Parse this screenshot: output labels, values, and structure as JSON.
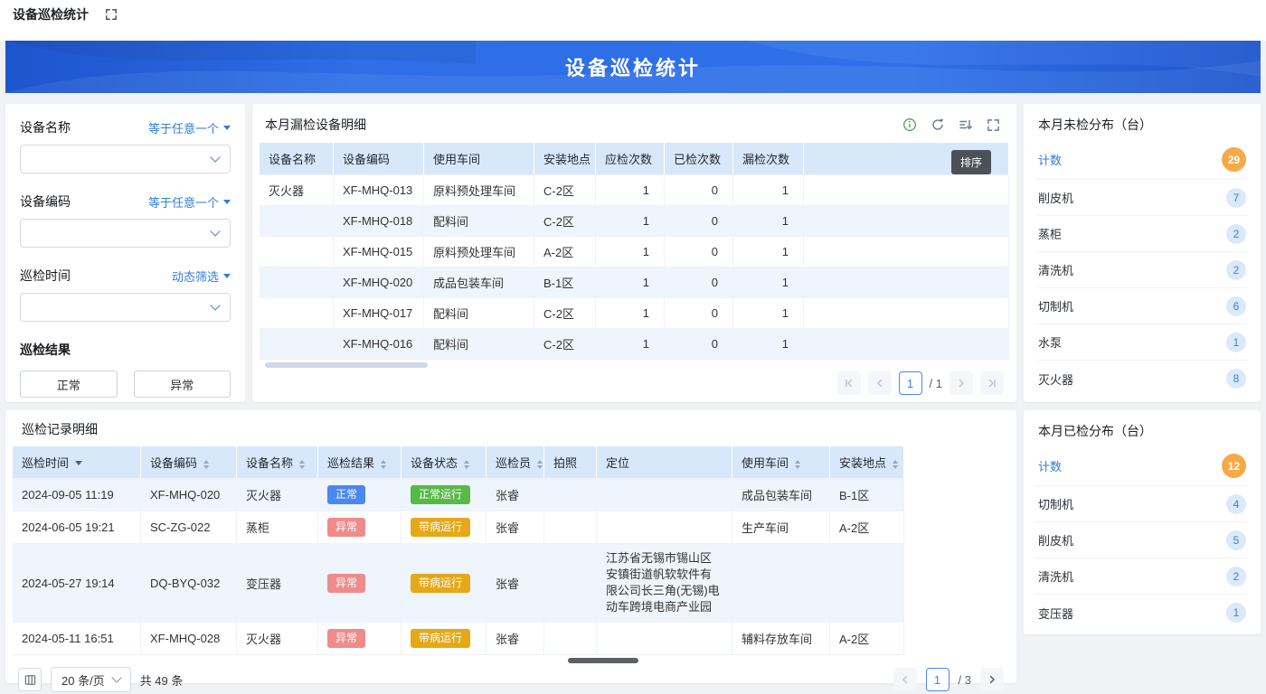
{
  "colors": {
    "banner_blue": "#2e6ee6",
    "table_header_blue": "#d7e8fa",
    "row_alt_blue": "#eef5fd",
    "link_blue": "#2e7ce0",
    "badge_normal_blue": "#4c86f0",
    "badge_abnormal_red": "#f08b8b",
    "badge_running_green": "#57b946",
    "badge_faulty_amber": "#e6a817",
    "count_badge_orange": "#f7a948",
    "item_badge_blue_bg": "#dbe9fa"
  },
  "icons": {
    "topbar": "fullscreen-expand",
    "missed_panel": [
      "info",
      "refresh",
      "sort",
      "fullscreen"
    ],
    "pagination": [
      "first-page",
      "prev-page",
      "next-page",
      "last-page"
    ],
    "records_tools": [
      "column-settings",
      "chevron-down"
    ],
    "header_sort": "up-down-arrows",
    "time_column_filter": "caret-down"
  },
  "topbar": {
    "title": "设备巡检统计"
  },
  "banner": {
    "title": "设备巡检统计"
  },
  "filters": {
    "device_name_label": "设备名称",
    "device_name_operator": "等于任意一个",
    "device_code_label": "设备编码",
    "device_code_operator": "等于任意一个",
    "time_label": "巡检时间",
    "time_operator": "动态筛选",
    "result_label": "巡检结果",
    "result_normal": "正常",
    "result_abnormal": "异常"
  },
  "missed_panel": {
    "title": "本月漏检设备明细",
    "sort_tooltip": "排序",
    "columns": [
      "设备名称",
      "设备编码",
      "使用车间",
      "安装地点",
      "应检次数",
      "已检次数",
      "漏检次数"
    ],
    "rows": [
      {
        "name": "灭火器",
        "code": "XF-MHQ-013",
        "workshop": "原料预处理车间",
        "location": "C-2区",
        "due": "1",
        "done": "0",
        "missed": "1"
      },
      {
        "name": "",
        "code": "XF-MHQ-018",
        "workshop": "配料间",
        "location": "C-2区",
        "due": "1",
        "done": "0",
        "missed": "1"
      },
      {
        "name": "",
        "code": "XF-MHQ-015",
        "workshop": "原料预处理车间",
        "location": "A-2区",
        "due": "1",
        "done": "0",
        "missed": "1"
      },
      {
        "name": "",
        "code": "XF-MHQ-020",
        "workshop": "成品包装车间",
        "location": "B-1区",
        "due": "1",
        "done": "0",
        "missed": "1"
      },
      {
        "name": "",
        "code": "XF-MHQ-017",
        "workshop": "配料间",
        "location": "C-2区",
        "due": "1",
        "done": "0",
        "missed": "1"
      },
      {
        "name": "",
        "code": "XF-MHQ-016",
        "workshop": "配料间",
        "location": "C-2区",
        "due": "1",
        "done": "0",
        "missed": "1"
      }
    ],
    "pagination": {
      "page": "1",
      "total": "/ 1"
    }
  },
  "records_panel": {
    "title": "巡检记录明细",
    "columns": [
      "巡检时间",
      "设备编码",
      "设备名称",
      "巡检结果",
      "设备状态",
      "巡检员",
      "拍照",
      "定位",
      "使用车间",
      "安装地点"
    ],
    "rows": [
      {
        "time": "2024-09-05 11:19",
        "code": "XF-MHQ-020",
        "name": "灭火器",
        "result": "正常",
        "status": "正常运行",
        "inspector": "张睿",
        "photo": "",
        "location": "",
        "workshop": "成品包装车间",
        "install": "B-1区"
      },
      {
        "time": "2024-06-05 19:21",
        "code": "SC-ZG-022",
        "name": "蒸柜",
        "result": "异常",
        "status": "带病运行",
        "inspector": "张睿",
        "photo": "",
        "location": "",
        "workshop": "生产车间",
        "install": "A-2区"
      },
      {
        "time": "2024-05-27 19:14",
        "code": "DQ-BYQ-032",
        "name": "变压器",
        "result": "异常",
        "status": "带病运行",
        "inspector": "张睿",
        "photo": "",
        "location": "江苏省无锡市锡山区安镇街道帆软软件有限公司长三角(无锡)电动车跨境电商产业园",
        "workshop": "",
        "install": ""
      },
      {
        "time": "2024-05-11 16:51",
        "code": "XF-MHQ-028",
        "name": "灭火器",
        "result": "异常",
        "status": "带病运行",
        "inspector": "张睿",
        "photo": "",
        "location": "",
        "workshop": "辅料存放车间",
        "install": "A-2区"
      }
    ],
    "pagination": {
      "page_size": "20 条/页",
      "total_count": "共 49 条",
      "page": "1",
      "total": "/ 3"
    }
  },
  "right_panels": {
    "unchecked": {
      "title": "本月未检分布（台）",
      "count_label": "计数",
      "count_value": "29",
      "items": [
        {
          "label": "削皮机",
          "value": "7"
        },
        {
          "label": "蒸柜",
          "value": "2"
        },
        {
          "label": "清洗机",
          "value": "2"
        },
        {
          "label": "切制机",
          "value": "6"
        },
        {
          "label": "水泵",
          "value": "1"
        },
        {
          "label": "灭火器",
          "value": "8"
        }
      ]
    },
    "checked": {
      "title": "本月已检分布（台）",
      "count_label": "计数",
      "count_value": "12",
      "items": [
        {
          "label": "切制机",
          "value": "4"
        },
        {
          "label": "削皮机",
          "value": "5"
        },
        {
          "label": "清洗机",
          "value": "2"
        },
        {
          "label": "变压器",
          "value": "1"
        }
      ]
    }
  }
}
